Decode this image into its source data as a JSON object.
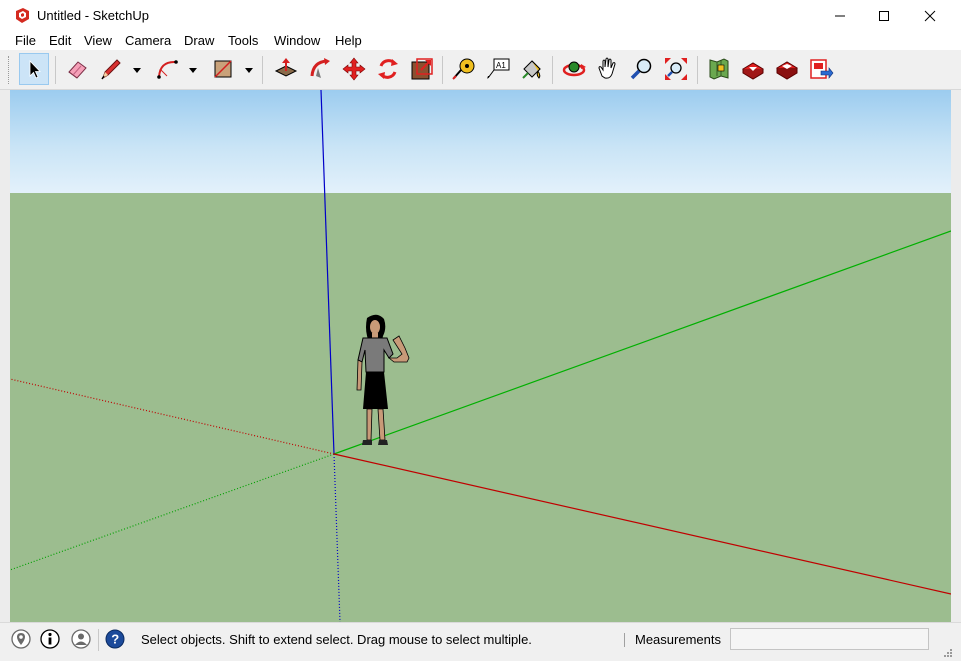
{
  "window": {
    "title": "Untitled - SketchUp",
    "controls": {
      "minimize_icon": "minimize-icon",
      "maximize_icon": "maximize-icon",
      "close_icon": "close-icon"
    }
  },
  "menu": [
    "File",
    "Edit",
    "View",
    "Camera",
    "Draw",
    "Tools",
    "Window",
    "Help"
  ],
  "toolbar": {
    "tools": [
      {
        "name": "select-tool",
        "icon": "arrow-cursor-icon",
        "active": true
      },
      {
        "name": "eraser-tool",
        "icon": "eraser-icon"
      },
      {
        "name": "line-tool",
        "icon": "pencil-icon",
        "dropdown": true
      },
      {
        "name": "arc-tool",
        "icon": "arc-icon",
        "dropdown": true
      },
      {
        "name": "rectangle-tool",
        "icon": "rectangle-icon",
        "dropdown": true
      },
      {
        "name": "push-pull-tool",
        "icon": "push-pull-icon"
      },
      {
        "name": "follow-me-tool",
        "icon": "follow-me-icon"
      },
      {
        "name": "move-tool",
        "icon": "move-icon"
      },
      {
        "name": "rotate-tool",
        "icon": "rotate-icon"
      },
      {
        "name": "scale-tool",
        "icon": "scale-icon"
      },
      {
        "name": "tape-measure-tool",
        "icon": "tape-measure-icon"
      },
      {
        "name": "text-tool",
        "icon": "text-icon",
        "label": "A1"
      },
      {
        "name": "paint-bucket-tool",
        "icon": "paint-bucket-icon"
      },
      {
        "name": "orbit-tool",
        "icon": "orbit-icon"
      },
      {
        "name": "pan-tool",
        "icon": "hand-icon"
      },
      {
        "name": "zoom-tool",
        "icon": "magnifier-icon"
      },
      {
        "name": "zoom-extents-tool",
        "icon": "zoom-extents-icon"
      },
      {
        "name": "3d-warehouse-button",
        "icon": "warehouse-icon"
      },
      {
        "name": "extension-warehouse-button",
        "icon": "extension-warehouse-icon"
      },
      {
        "name": "layout-button",
        "icon": "layout-icon"
      },
      {
        "name": "send-to-layout-button",
        "icon": "send-to-layout-icon"
      }
    ]
  },
  "colors": {
    "sky_top": "#9cccef",
    "ground": "#9cbd8f",
    "axis_red": "#c00000",
    "axis_green": "#00b000",
    "axis_blue": "#0000c8",
    "active_tool_bg": "#cce4f7"
  },
  "status": {
    "icons": [
      "geo-location-icon",
      "credits-icon",
      "user-account-icon",
      "instructor-help-icon"
    ],
    "message": "Select objects. Shift to extend select. Drag mouse to select multiple.",
    "measurements_label": "Measurements",
    "measurements_value": ""
  }
}
